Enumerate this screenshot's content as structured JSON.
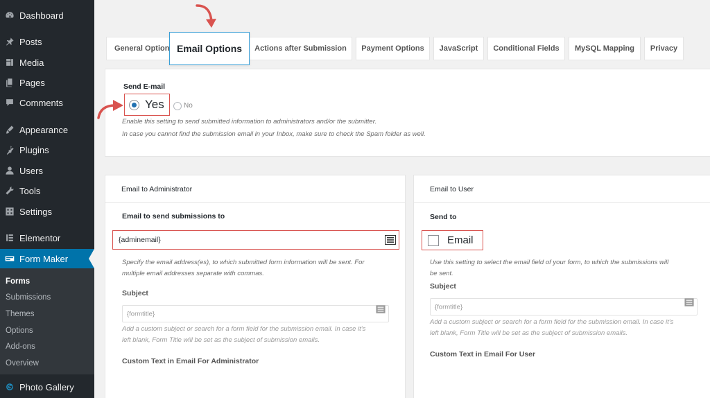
{
  "sidebar": {
    "items": [
      {
        "label": "Dashboard",
        "icon": "dashboard-icon"
      },
      {
        "label": "Posts",
        "icon": "pushpin-icon"
      },
      {
        "label": "Media",
        "icon": "media-icon"
      },
      {
        "label": "Pages",
        "icon": "pages-icon"
      },
      {
        "label": "Comments",
        "icon": "comment-icon"
      },
      {
        "label": "Appearance",
        "icon": "paintbrush-icon"
      },
      {
        "label": "Plugins",
        "icon": "plugin-icon"
      },
      {
        "label": "Users",
        "icon": "user-icon"
      },
      {
        "label": "Tools",
        "icon": "wrench-icon"
      },
      {
        "label": "Settings",
        "icon": "settings-icon"
      },
      {
        "label": "Elementor",
        "icon": "elementor-icon"
      },
      {
        "label": "Form Maker",
        "icon": "form-icon"
      }
    ],
    "submenu": [
      "Forms",
      "Submissions",
      "Themes",
      "Options",
      "Add-ons",
      "Overview"
    ],
    "photo_gallery": "Photo Gallery"
  },
  "tabs": [
    "General Options",
    "Email Options",
    "Actions after Submission",
    "Payment Options",
    "JavaScript",
    "Conditional Fields",
    "MySQL Mapping",
    "Privacy"
  ],
  "send_email": {
    "label": "Send E-mail",
    "yes": "Yes",
    "no": "No",
    "desc1": "Enable this setting to send submitted information to administrators and/or the submitter.",
    "desc2": "In case you cannot find the submission email in your Inbox, make sure to check the Spam folder as well."
  },
  "admin": {
    "header": "Email to Administrator",
    "send_label": "Email to send submissions to",
    "send_value": "{adminemail}",
    "send_desc1": "Specify the email address(es), to which submitted form information will be sent. For",
    "send_desc2": "multiple email addresses separate with commas.",
    "subject_label": "Subject",
    "subject_value": "{formtitle}",
    "subject_desc1": "Add a custom subject or search for a form field for the submission email. In case it's",
    "subject_desc2": "left blank, Form Title will be set as the subject of submission emails.",
    "custom_label": "Custom Text in Email For Administrator"
  },
  "user": {
    "header": "Email to User",
    "send_label": "Send to",
    "checkbox_label": "Email",
    "send_desc1": "Use this setting to select the email field of your form, to which the submissions will",
    "send_desc2": "be sent.",
    "subject_label": "Subject",
    "subject_value": "{formtitle}",
    "subject_desc1": "Add a custom subject or search for a form field for the submission email. In case it's",
    "subject_desc2": "left blank, Form Title will be set as the subject of submission emails.",
    "custom_label": "Custom Text in Email For User"
  },
  "colors": {
    "accent": "#0073aa",
    "annotation": "#d9534f"
  }
}
